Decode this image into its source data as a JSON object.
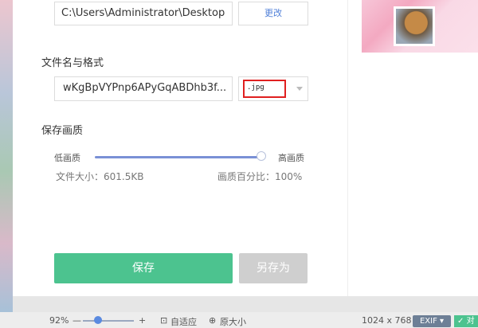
{
  "save_path": {
    "value": "C:\\Users\\Administrator\\Desktop",
    "change_label": "更改"
  },
  "filename_section": {
    "label": "文件名与格式",
    "name_value": "wKgBpVYPnp6APyGqABDhb3f...",
    "format_value": ".jpg"
  },
  "quality_section": {
    "label": "保存画质",
    "low_label": "低画质",
    "high_label": "高画质",
    "level_percent": 100,
    "file_size": "文件大小：601.5KB",
    "quality_percent": "画质百分比：100%"
  },
  "buttons": {
    "save": "保存",
    "save_as": "另存为"
  },
  "status_bar": {
    "zoom": "92%",
    "minus": "—",
    "plus": "+",
    "fit": "自适应",
    "original": "原大小",
    "dimensions": "1024 x 768",
    "exif": "EXIF",
    "compare": "对"
  },
  "icons": {
    "fit": "fit-to-window-icon",
    "original": "zoom-original-icon",
    "dropdown": "chevron-down-icon"
  },
  "colors": {
    "accent_green": "#4cc38f",
    "slider_blue": "#7a90d6",
    "highlight_red": "#e02020",
    "link_blue": "#4f7fd8"
  }
}
